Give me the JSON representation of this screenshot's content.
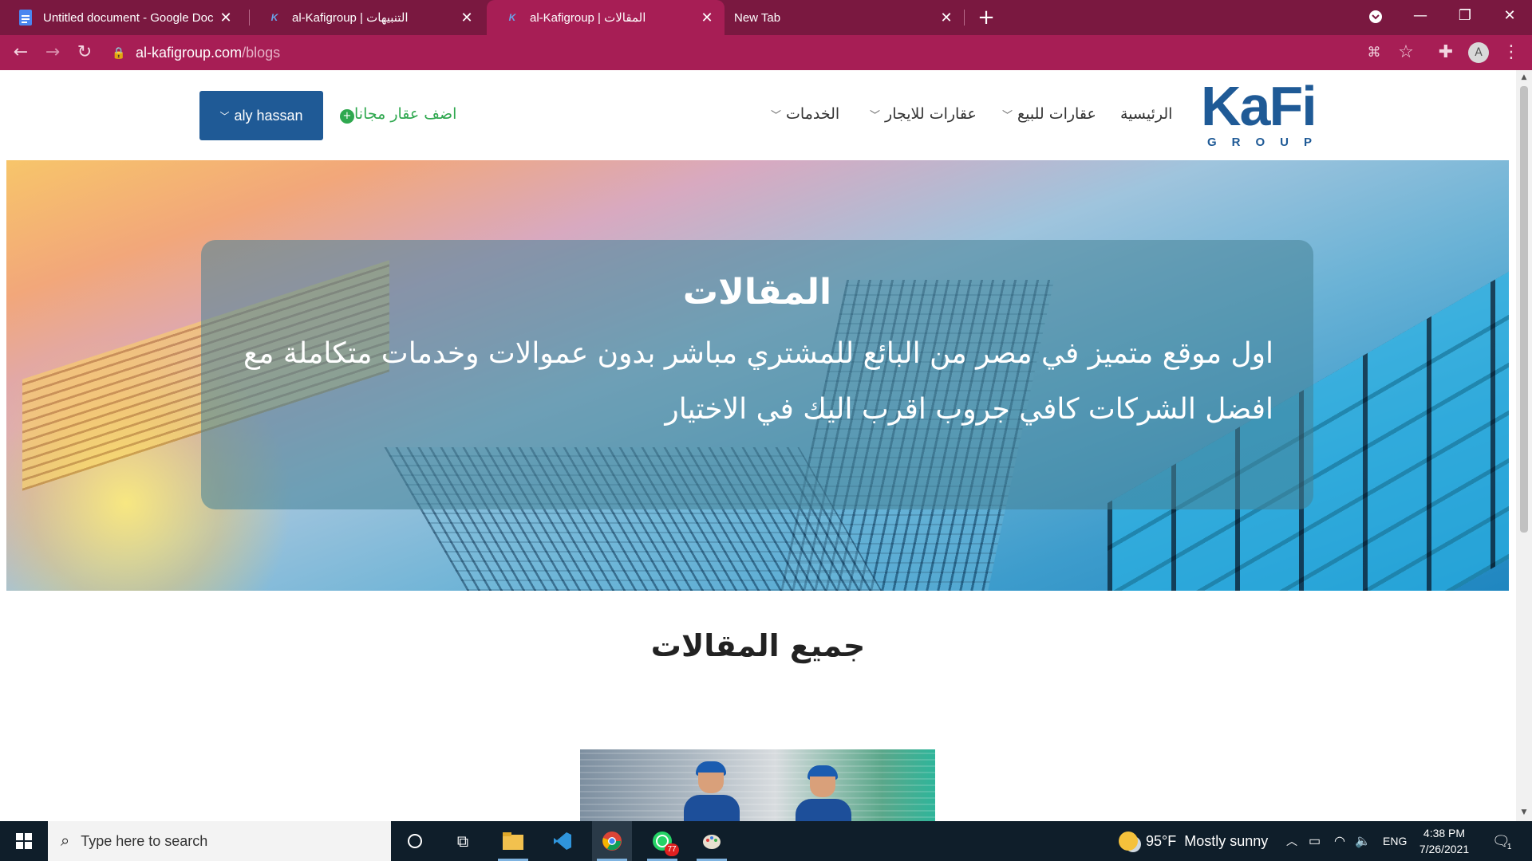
{
  "browser": {
    "tabs": [
      {
        "title": "Untitled document - Google Doc",
        "icon": "google-docs-icon",
        "active": false
      },
      {
        "title": "al-Kafigroup | التنبيهات",
        "icon": "kafi-favicon-icon",
        "active": false
      },
      {
        "title": "al-Kafigroup | المقالات",
        "icon": "kafi-favicon-icon",
        "active": true
      },
      {
        "title": "New Tab",
        "icon": "",
        "active": false
      }
    ],
    "url_host": "al-kafigroup.com",
    "url_path": "/blogs",
    "profile_initial": "A",
    "accent": "#a71e55",
    "frame": "#7a1840"
  },
  "site": {
    "logo_main": "KaFi",
    "logo_sub": "GROUP",
    "brand_color": "#1f5a96",
    "nav": {
      "home": "الرئيسية",
      "for_sale": "عقارات للبيع",
      "for_rent": "عقارات للايجار",
      "services": "الخدمات"
    },
    "add_property": "اضف عقار مجانا",
    "user_name": "aly hassan",
    "hero": {
      "title": "المقالات",
      "text": "اول موقع متميز في مصر من البائع للمشتري مباشر بدون عموالات وخدمات متكاملة مع افضل الشركات كافي جروب اقرب اليك في الاختيار"
    },
    "section_title": "جميع المقالات"
  },
  "taskbar": {
    "search_placeholder": "Type here to search",
    "whatsapp_badge": "77",
    "weather_temp": "95°F",
    "weather_desc": "Mostly sunny",
    "language": "ENG",
    "time": "4:38 PM",
    "date": "7/26/2021",
    "notification_count": "1"
  }
}
